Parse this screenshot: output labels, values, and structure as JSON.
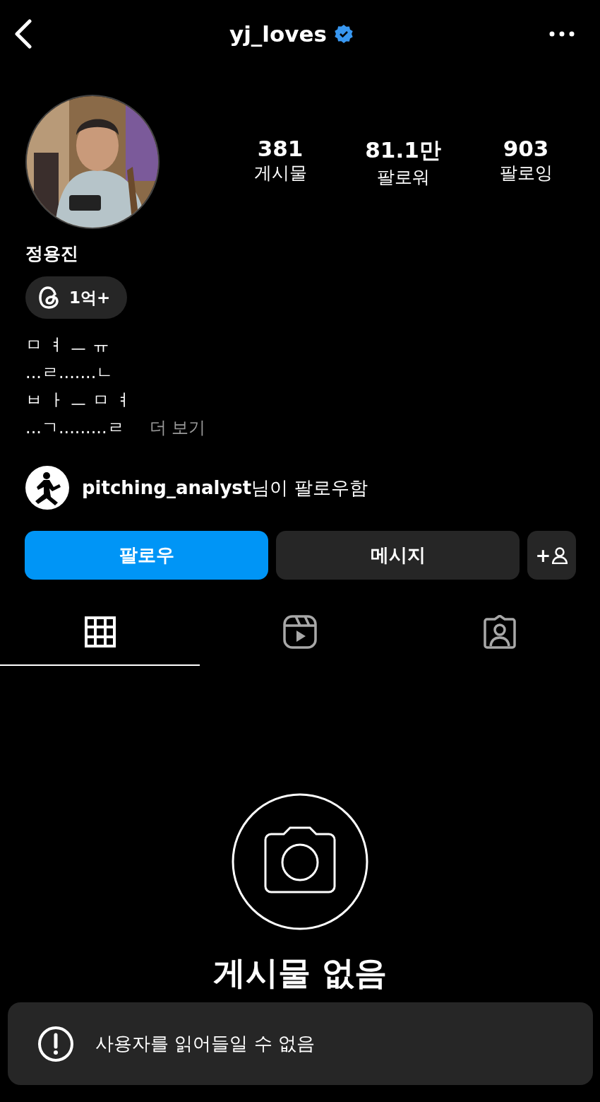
{
  "header": {
    "username": "yj_loves",
    "verified": true
  },
  "stats": [
    {
      "value": "381",
      "label": "게시물"
    },
    {
      "value": "81.1만",
      "label": "팔로워"
    },
    {
      "value": "903",
      "label": "팔로잉"
    }
  ],
  "name": "정용진",
  "threads_badge": {
    "count": "1억+"
  },
  "bio": {
    "lines": [
      "ㅁ ㅕ ㅡ ㅠ",
      "...ㄹ.......ㄴ",
      "ㅂ ㅏ ㅡ ㅁ ㅕ",
      "...ㄱ.........ㄹ"
    ],
    "more": "더 보기"
  },
  "followed_by": "**pitching_analyst**님이 팔로우함",
  "buttons": [
    {
      "kind": "primary",
      "label": "팔로우"
    },
    {
      "kind": "secondary",
      "label": "메시지"
    },
    {
      "kind": "add_person",
      "label": "+"
    }
  ],
  "tabs": [
    {
      "kind": "grid",
      "selected": true
    },
    {
      "kind": "reels",
      "selected": false
    },
    {
      "kind": "tagged",
      "selected": false
    }
  ],
  "empty_state": {
    "title": "게시물 없음"
  },
  "toast": {
    "message": "사용자를 읽어들일 수 없음"
  }
}
